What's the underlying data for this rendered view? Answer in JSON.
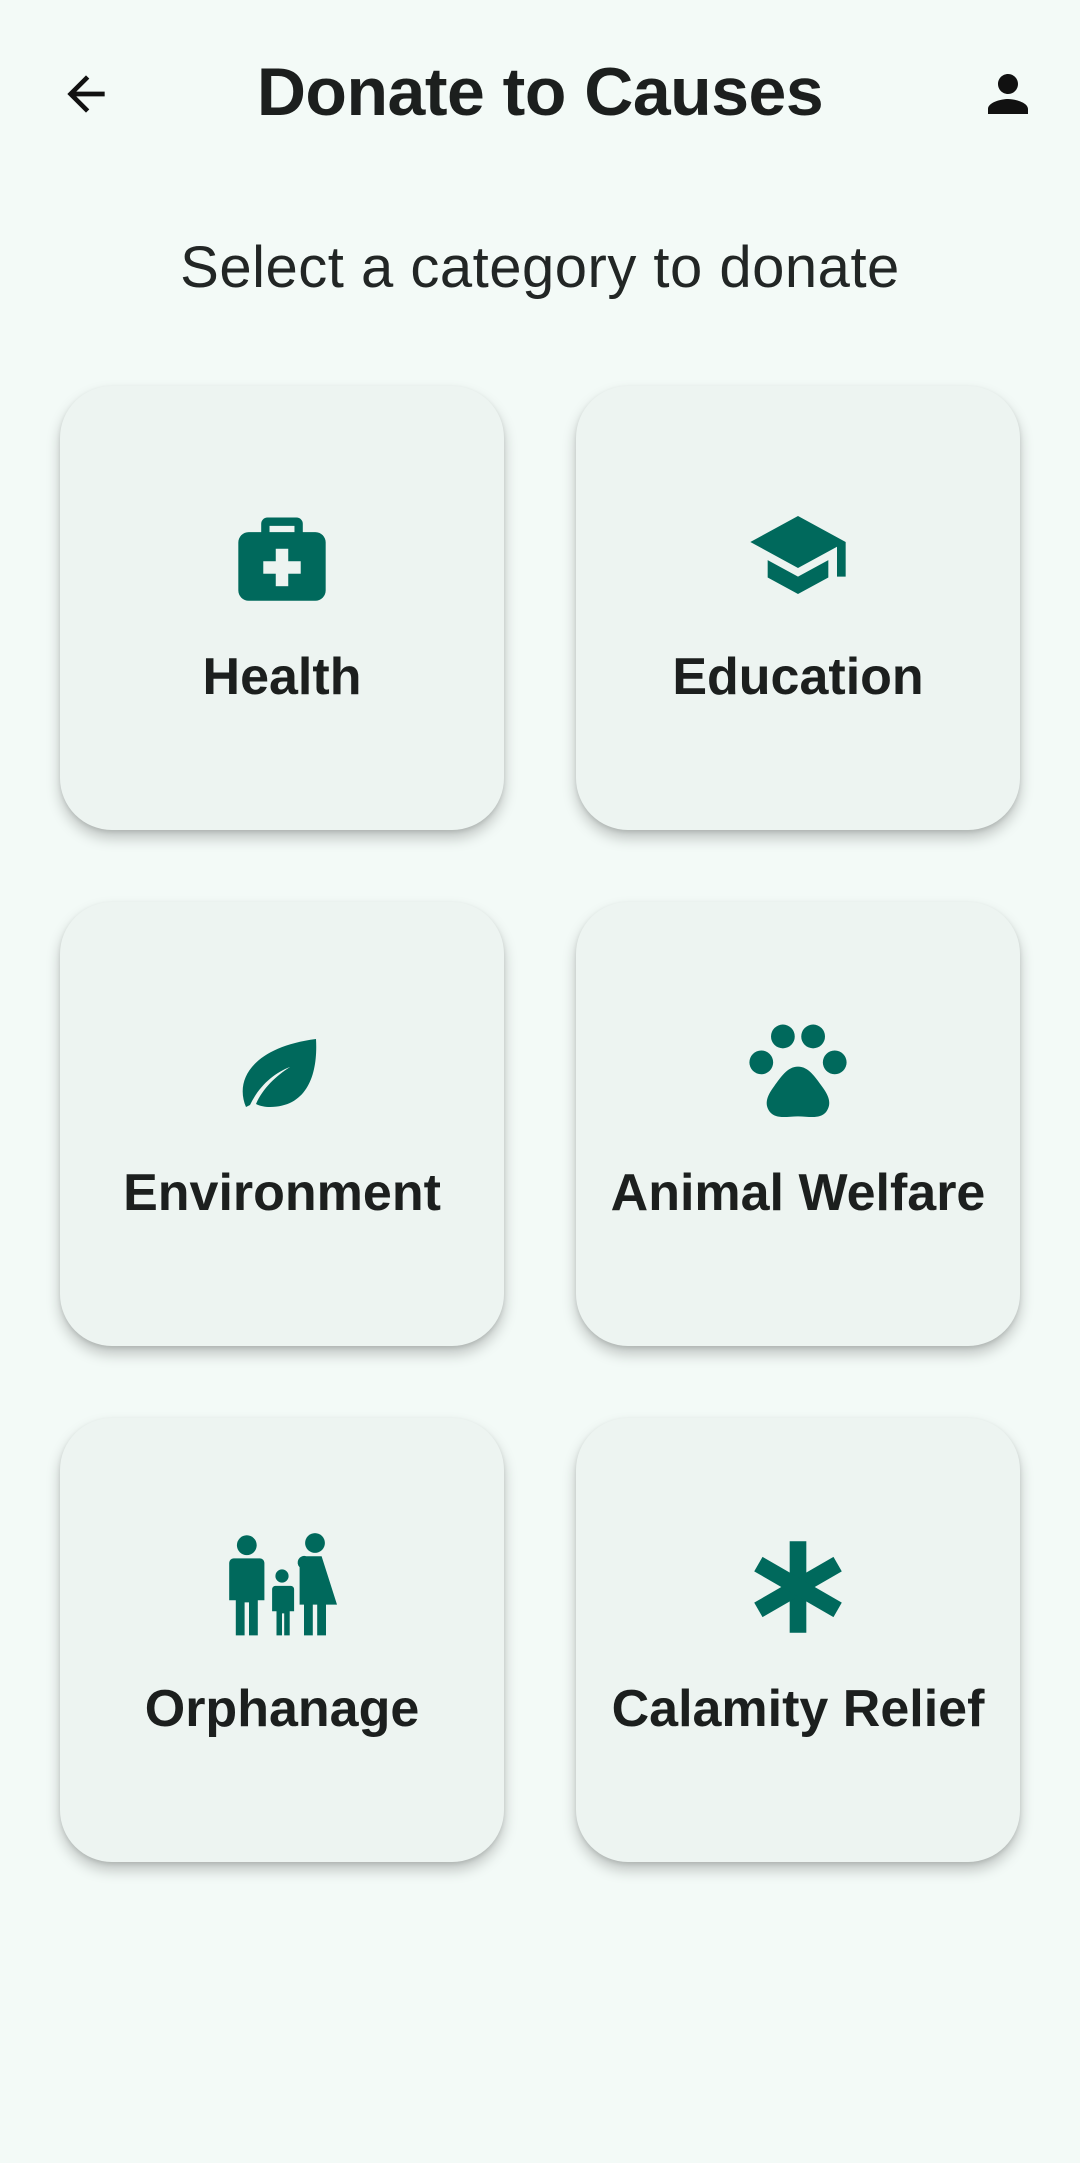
{
  "header": {
    "title": "Donate to Causes",
    "back_icon": "arrow-back-icon",
    "profile_icon": "person-icon"
  },
  "subtitle": "Select a category to donate",
  "theme": {
    "accent": "#00695c",
    "background": "#f3faf7",
    "card": "#edf4f1"
  },
  "categories": [
    {
      "label": "Health",
      "icon": "medical-bag-icon"
    },
    {
      "label": "Education",
      "icon": "graduation-cap-icon"
    },
    {
      "label": "Environment",
      "icon": "leaf-icon"
    },
    {
      "label": "Animal Welfare",
      "icon": "paw-icon"
    },
    {
      "label": "Orphanage",
      "icon": "family-icon"
    },
    {
      "label": "Calamity Relief",
      "icon": "asterisk-icon"
    }
  ]
}
